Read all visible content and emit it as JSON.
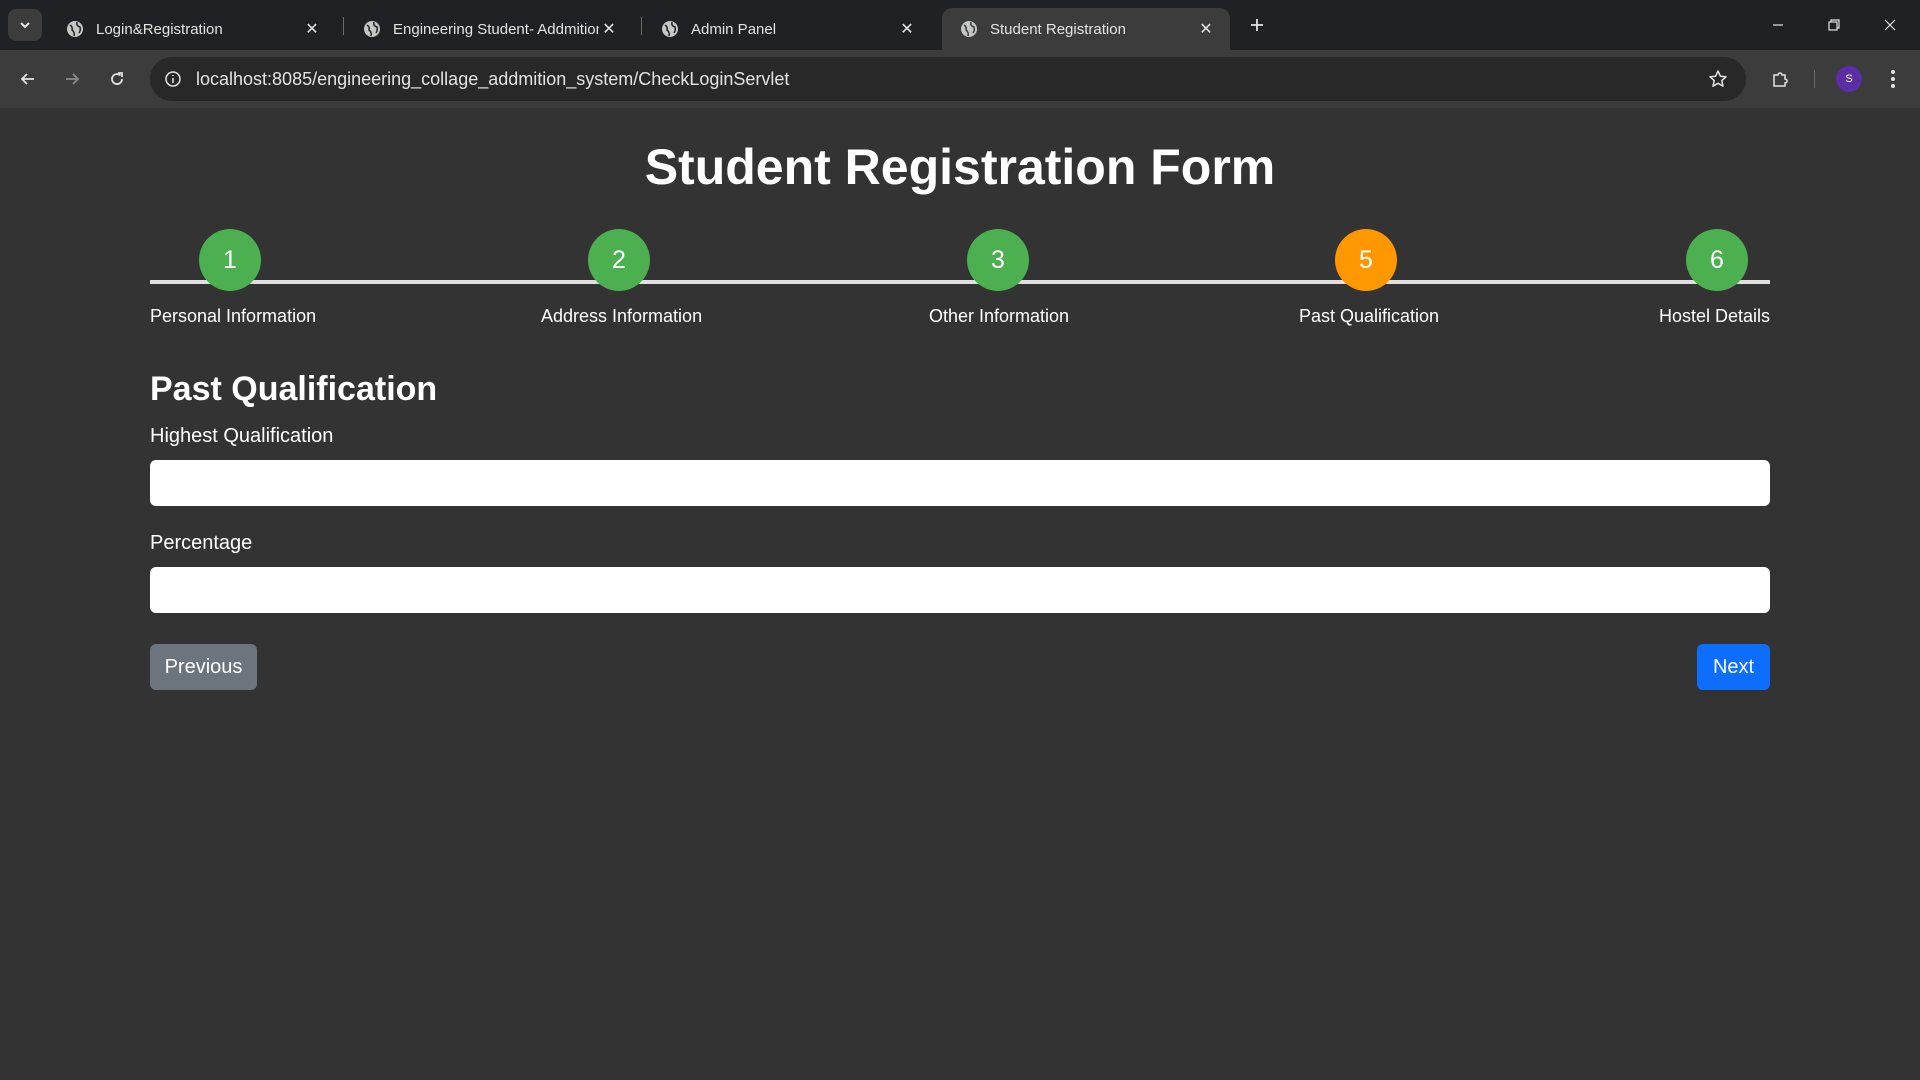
{
  "browser": {
    "tabs": [
      {
        "title": "Login&Registration"
      },
      {
        "title": "Engineering Student- Addmition"
      },
      {
        "title": "Admin Panel"
      },
      {
        "title": "Student Registration"
      }
    ],
    "url": "localhost:8085/engineering_collage_addmition_system/CheckLoginServlet",
    "profile_initial": "S"
  },
  "form": {
    "title": "Student Registration Form",
    "steps": [
      {
        "number": "1",
        "label": "Personal Information",
        "status": "complete",
        "color": "#4caf50"
      },
      {
        "number": "2",
        "label": "Address Information",
        "status": "complete",
        "color": "#4caf50"
      },
      {
        "number": "3",
        "label": "Other Information",
        "status": "complete",
        "color": "#4caf50"
      },
      {
        "number": "5",
        "label": "Past Qualification",
        "status": "active",
        "color": "#ff9800"
      },
      {
        "number": "6",
        "label": "Hostel Details",
        "status": "complete",
        "color": "#4caf50"
      }
    ],
    "section_title": "Past Qualification",
    "fields": [
      {
        "label": "Highest Qualification",
        "value": "",
        "placeholder": ""
      },
      {
        "label": "Percentage",
        "value": "",
        "placeholder": ""
      }
    ],
    "buttons": {
      "previous": "Previous",
      "next": "Next"
    }
  },
  "colors": {
    "page_background": "#333333",
    "step_complete": "#4caf50",
    "step_active": "#ff9800",
    "previous_button": "#6c757d",
    "next_button": "#0d6efd"
  }
}
